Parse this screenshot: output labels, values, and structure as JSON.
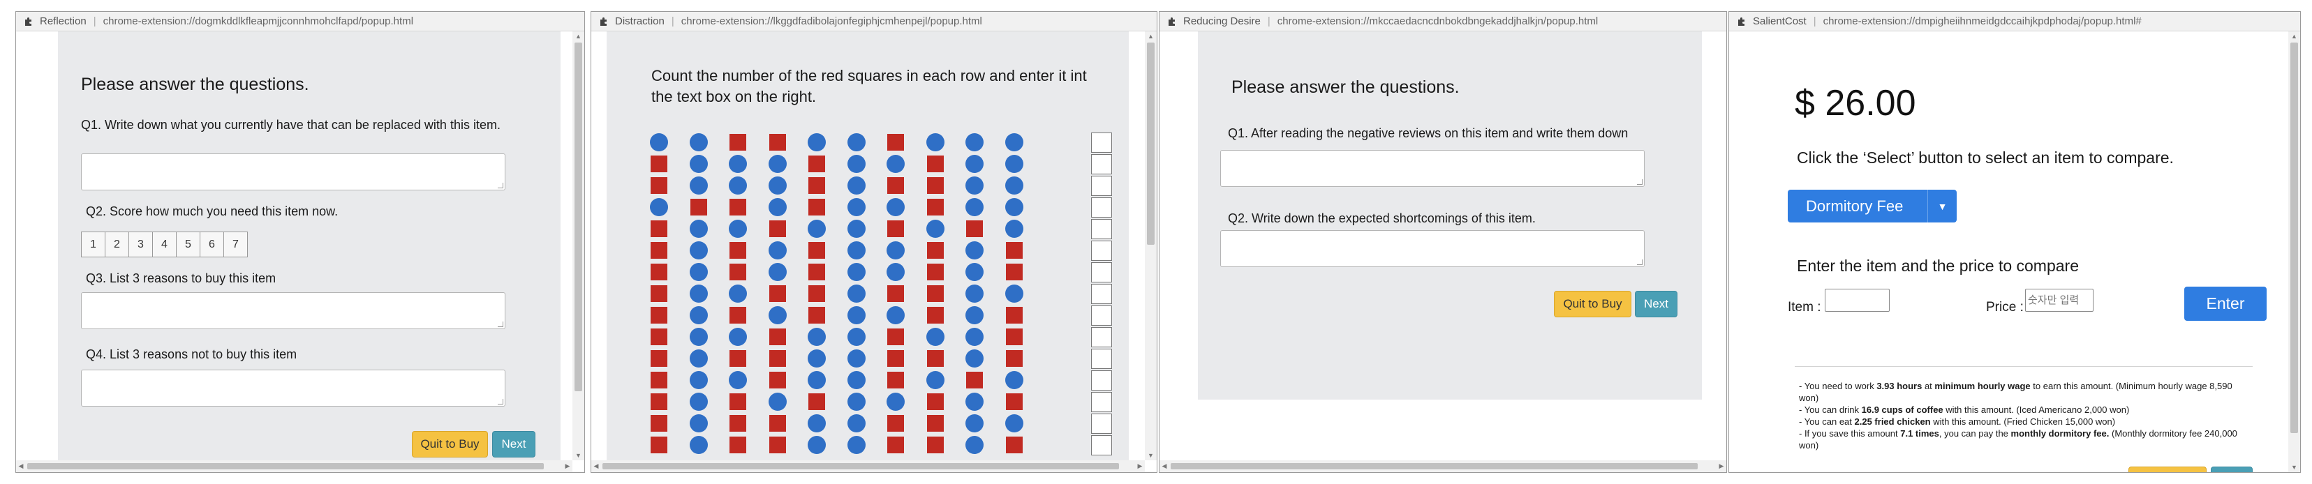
{
  "windows": {
    "reflection": {
      "title": "Reflection",
      "url": "chrome-extension://dogmkddlkfleapmjjconnhmohclfapd/popup.html",
      "heading": "Please answer the questions.",
      "q1": "Q1. Write down what you currently have that can be replaced with this item.",
      "q2": "Q2. Score how much you need this item now.",
      "scale": [
        "1",
        "2",
        "3",
        "4",
        "5",
        "6",
        "7"
      ],
      "q3": "Q3. List 3 reasons to buy this item",
      "q4": "Q4. List 3 reasons not to buy this item",
      "quit_label": "Quit to Buy",
      "next_label": "Next"
    },
    "distraction": {
      "title": "Distraction",
      "url": "chrome-extension://lkggdfadibolajonfegiphjcmhenpejl/popup.html",
      "instruction": "Count the number of the red squares in each row and enter it int the text box on the right.",
      "grid": [
        "CCSSCCSCCC",
        "SCCCSCCSCC",
        "SCCCSCSSCC",
        "CSSCSCCSCC",
        "SCCSCCSCSC",
        "SCSCSCCSCS",
        "SCSCSCCSCS",
        "SCCSSCSSCC",
        "SCSCSCCSCS",
        "SCCSCCSCCS",
        "SCSSCCSSCS",
        "SCCSCCSCSC",
        "SCSCSCCSCS",
        "SCSSCCSSCC",
        "SCSSCCSSCS"
      ]
    },
    "reducing": {
      "title": "Reducing Desire",
      "url": "chrome-extension://mkccaedacncdnbokdbngekaddjhalkjn/popup.html",
      "heading": "Please answer the questions.",
      "q1": "Q1. After reading the negative reviews on this item and write them down",
      "q2": "Q2. Write down the expected shortcomings of this item.",
      "quit_label": "Quit to Buy",
      "next_label": "Next"
    },
    "salient": {
      "title": "SalientCost",
      "url": "chrome-extension://dmpigheiihnmeidgdccaihjkpdphodaj/popup.html#",
      "price": "$ 26.00",
      "select_prompt": "Click the ‘Select’ button to select an item to compare.",
      "dropdown_label": "Dormitory Fee",
      "compare_prompt": "Enter the item and the price to compare",
      "item_label": "Item :",
      "price_label": "Price :",
      "price_placeholder": "숫자만 입력",
      "enter_label": "Enter",
      "info": [
        {
          "a": "- You need to work ",
          "b": "3.93 hours",
          "c": " at ",
          "d": "minimum hourly wage",
          "e": " to earn this amount. (Minimum hourly wage 8,590 won)"
        },
        {
          "a": "- You can drink ",
          "b": "16.9 cups of coffee",
          "c": " with this amount. (Iced Americano 2,000 won)",
          "d": "",
          "e": ""
        },
        {
          "a": "- You can eat ",
          "b": "2.25 fried chicken",
          "c": " with this amount. (Fried Chicken 15,000 won)",
          "d": "",
          "e": ""
        },
        {
          "a": "- If you save this amount ",
          "b": "7.1 times",
          "c": ", you can pay the ",
          "d": "monthly dormitory fee.",
          "e": " (Monthly dormitory fee 240,000 won)"
        }
      ]
    }
  },
  "colors": {
    "panel": "#e9eaec",
    "red_square": "#c12a22",
    "blue_circle": "#2f6fc6",
    "yellow_button": "#f5c242",
    "teal_button": "#4a9fb5",
    "blue_button": "#2f7de1"
  },
  "icons": {
    "extension": "puzzle-icon"
  }
}
